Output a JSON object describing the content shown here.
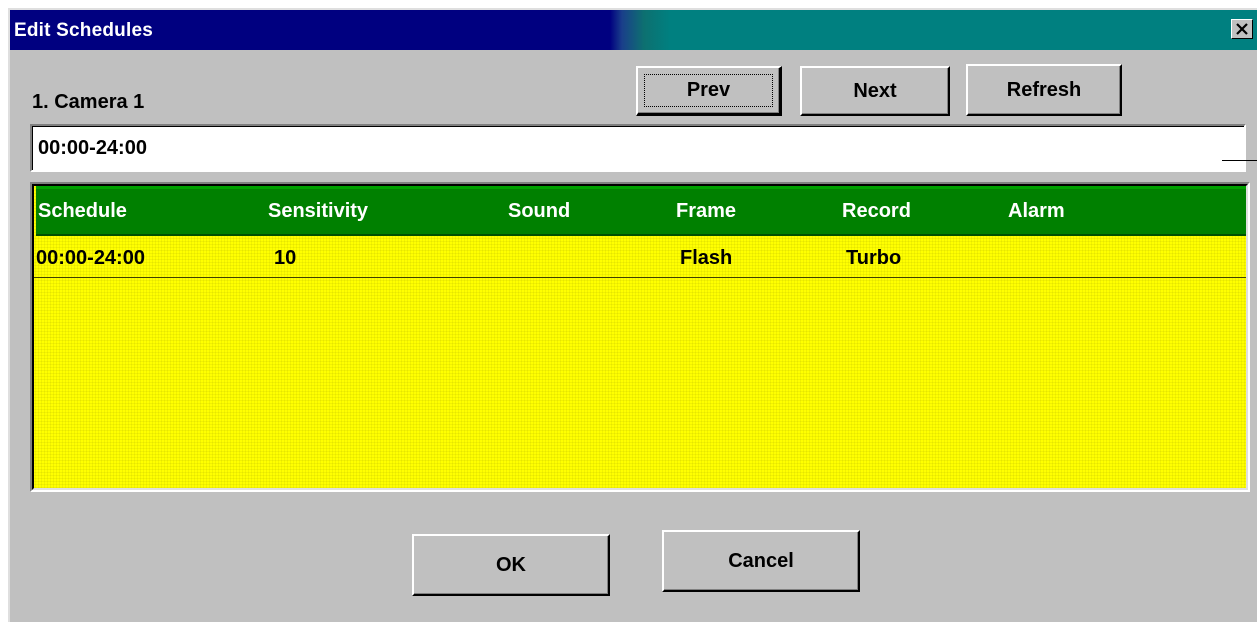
{
  "window": {
    "title": "Edit Schedules",
    "close_glyph": "×"
  },
  "camera_label": "1. Camera 1",
  "nav": {
    "prev_label": "Prev",
    "next_label": "Next",
    "refresh_label": "Refresh"
  },
  "schedule_field": {
    "value": "00:00-24:00"
  },
  "table": {
    "columns": [
      "Schedule",
      "Sensitivity",
      "Sound",
      "Frame",
      "Record",
      "Alarm"
    ],
    "rows": [
      {
        "schedule": "00:00-24:00",
        "sensitivity": "10",
        "sound": "",
        "frame": "Flash",
        "record": "Turbo",
        "alarm": ""
      }
    ]
  },
  "footer": {
    "ok_label": "OK",
    "cancel_label": "Cancel"
  },
  "colors": {
    "title_bar_start": "#000080",
    "title_bar_end": "#008080",
    "table_header": "#008000",
    "table_body": "#ffff00",
    "dialog_face": "#c0c0c0"
  }
}
